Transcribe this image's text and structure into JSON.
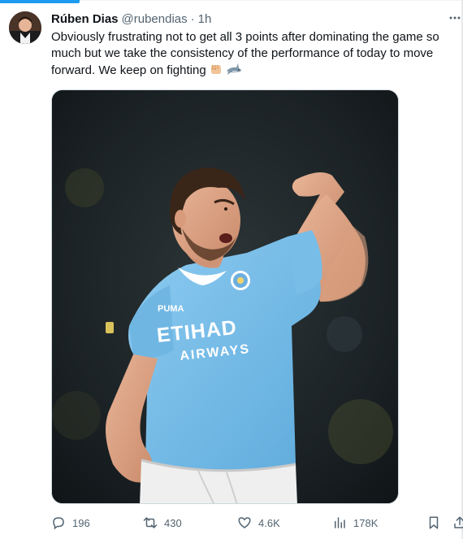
{
  "tweet": {
    "author_name": "Rúben Dias",
    "handle": "@rubendias",
    "separator": "·",
    "time": "1h",
    "text_lines": [
      "Obviously frustrating not to get all 3 points after dominating the game so",
      "much but we take the consistency of the performance of today to move",
      "forward. We keep on fighting"
    ],
    "emojis": [
      "fist-icon",
      "shark-icon"
    ]
  },
  "media": {
    "jersey_sponsor_line1": "ETIHAD",
    "jersey_sponsor_line2": "AIRWAYS",
    "jersey_brand": "PUMA",
    "colors": {
      "jersey": "#7ec3ec",
      "shorts": "#f1f1f1",
      "background": "#1a1f22"
    }
  },
  "metrics": {
    "replies": "196",
    "retweets": "430",
    "likes": "4.6K",
    "views": "178K"
  },
  "colors": {
    "accent": "#1d9bf0",
    "text": "#0f1419",
    "secondary": "#536471"
  }
}
